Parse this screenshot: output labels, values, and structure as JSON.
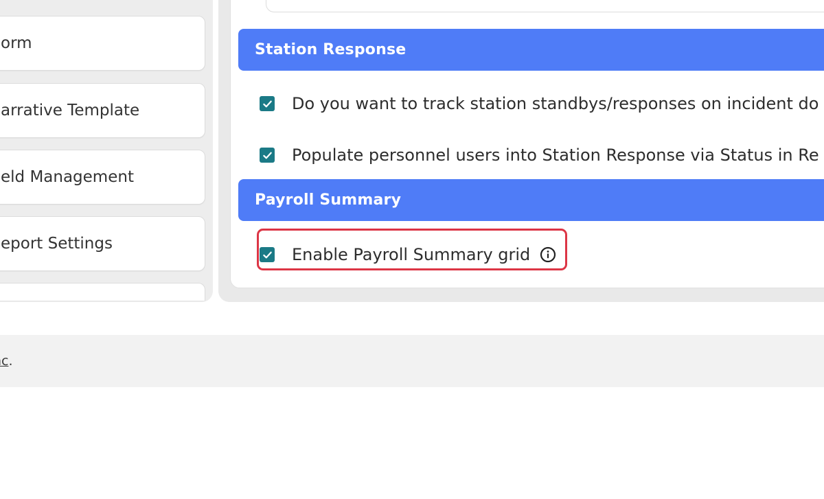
{
  "sidebar": {
    "items": [
      {
        "label": "orm"
      },
      {
        "label": "arrative Template"
      },
      {
        "label": "eld Management"
      },
      {
        "label": "eport Settings"
      },
      {
        "label": ""
      }
    ]
  },
  "sections": {
    "station_response": {
      "title": "Station Response",
      "options": [
        {
          "label": "Do you want to track station standbys/responses on incident do",
          "checked": true
        },
        {
          "label": "Populate personnel users into Station Response via Status in Re",
          "checked": true
        }
      ]
    },
    "payroll_summary": {
      "title": "Payroll Summary",
      "options": [
        {
          "label": "Enable Payroll Summary grid",
          "checked": true,
          "info_icon": "info-circle-icon"
        }
      ]
    }
  },
  "footer": {
    "link_text": "nc",
    "suffix": "."
  },
  "colors": {
    "header_blue": "#4f7cf7",
    "checkbox_teal": "#1b7a86",
    "highlight_red": "#dc3545"
  }
}
